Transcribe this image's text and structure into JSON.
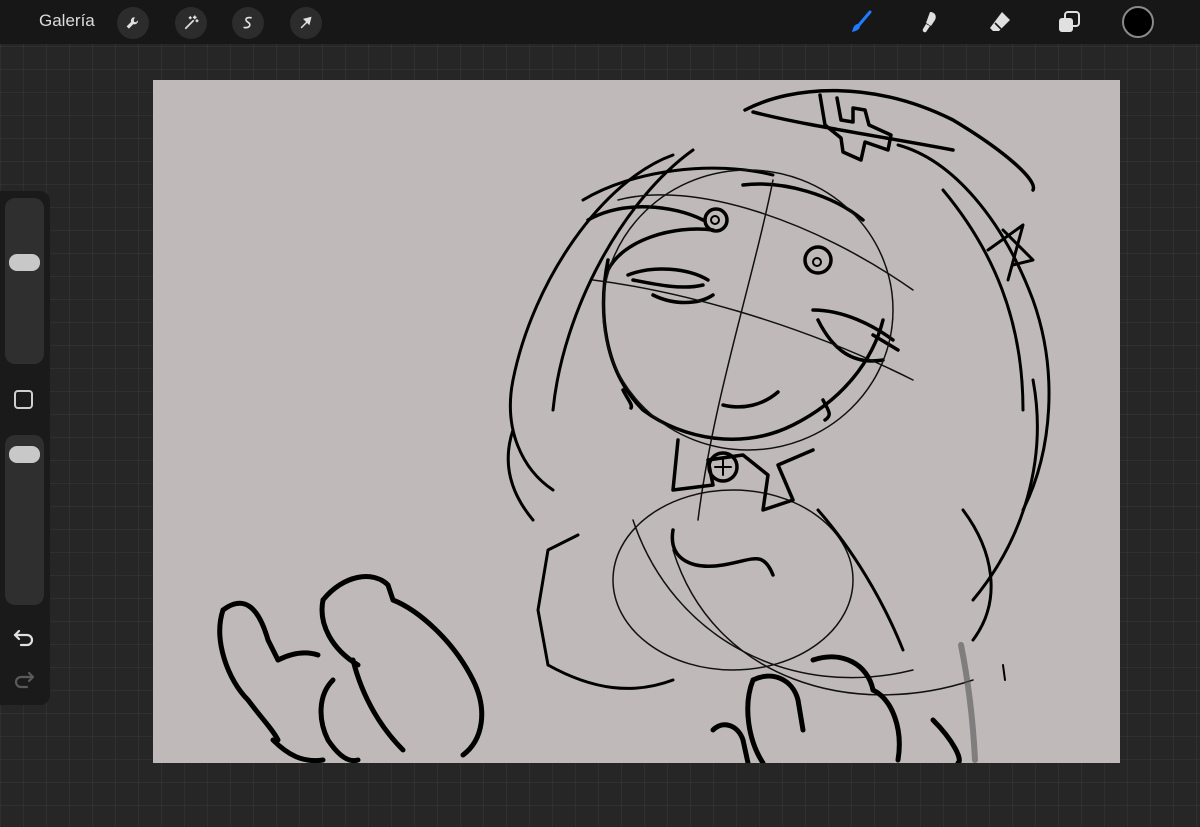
{
  "topbar": {
    "gallery_label": "Galería",
    "left_tools": [
      {
        "icon": "wrench-icon",
        "name": "actions"
      },
      {
        "icon": "magic-wand-icon",
        "name": "adjustments"
      },
      {
        "icon": "selection-icon",
        "name": "selection"
      },
      {
        "icon": "transform-arrow-icon",
        "name": "transform"
      }
    ],
    "right_tools": [
      {
        "icon": "brush-icon",
        "name": "paint",
        "active": true
      },
      {
        "icon": "smudge-icon",
        "name": "smudge"
      },
      {
        "icon": "eraser-icon",
        "name": "eraser"
      },
      {
        "icon": "layers-icon",
        "name": "layers"
      }
    ],
    "active_color": "#000000",
    "accent_color": "#1f7bff"
  },
  "sidebar": {
    "brush_size_level": 0.37,
    "opacity_level": 0.05
  },
  "canvas": {
    "background_color": "#bfbab9"
  }
}
